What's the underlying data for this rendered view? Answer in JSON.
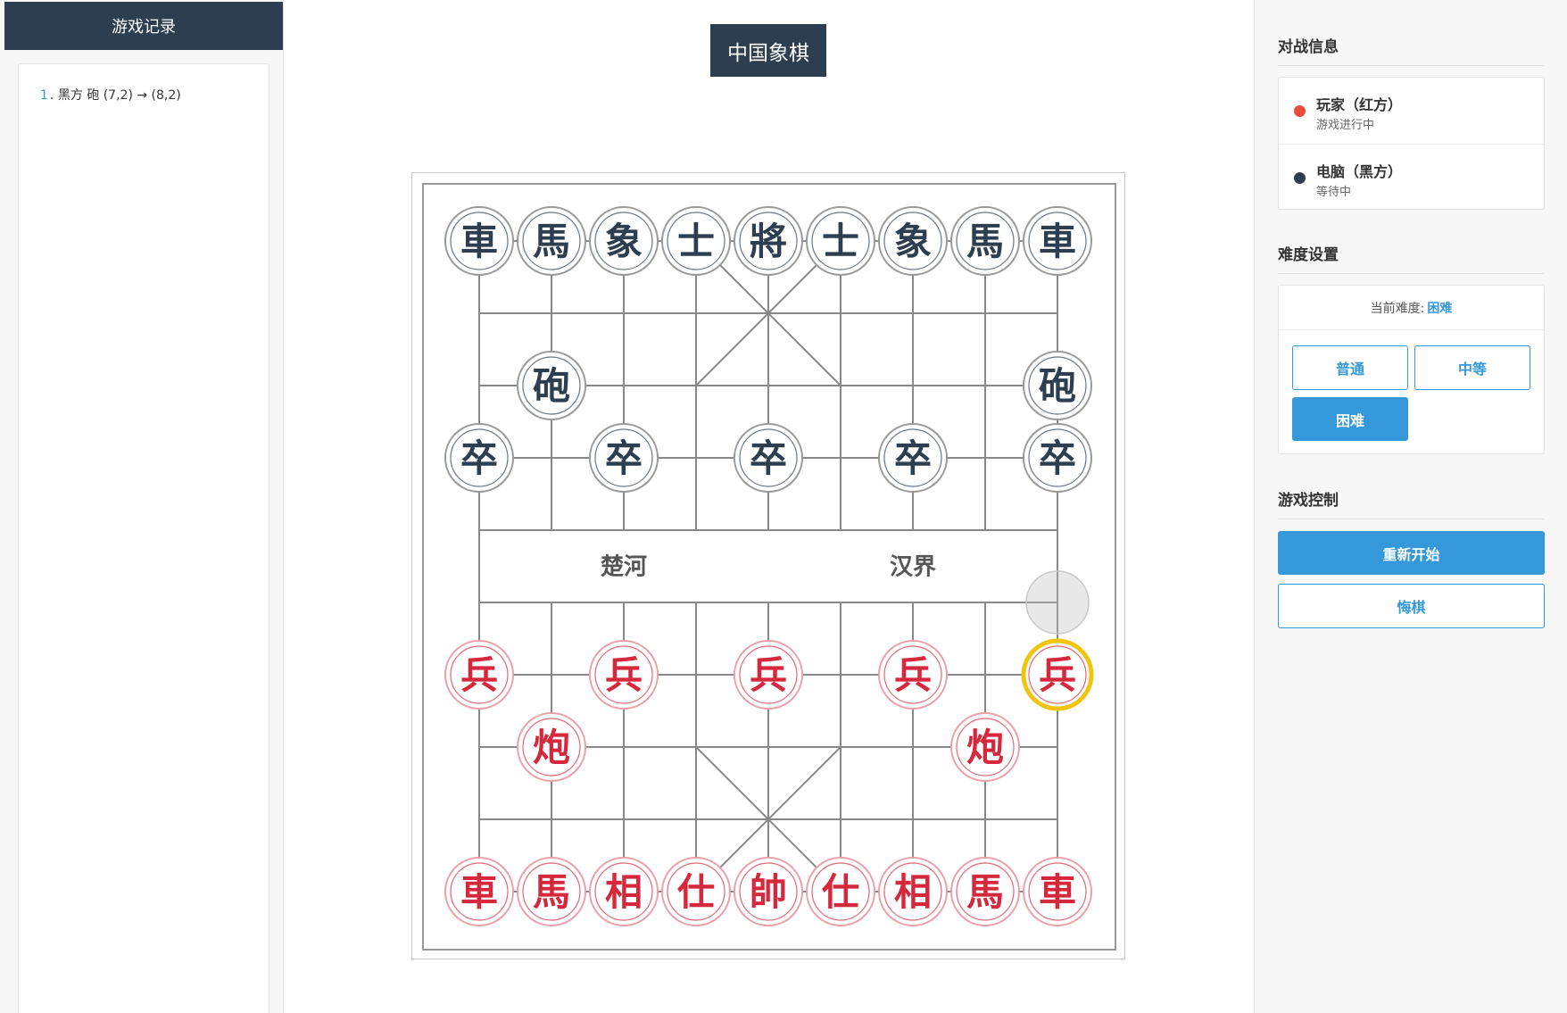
{
  "log": {
    "title": "游戏记录",
    "entries": [
      {
        "num": "1",
        "text": ". 黑方 砲 (7,2) → (8,2)"
      }
    ]
  },
  "title": "中国象棋",
  "board": {
    "river_left": "楚河",
    "river_right": "汉界",
    "colors": {
      "red": "#d6283c",
      "black": "#2c3e50",
      "line": "#888888",
      "highlight": "#f1c40f"
    },
    "last_move_from": {
      "col": 8,
      "row": 5
    },
    "selected": {
      "col": 8,
      "row": 6
    },
    "pieces": [
      {
        "side": "black",
        "char": "車",
        "col": 0,
        "row": 0
      },
      {
        "side": "black",
        "char": "馬",
        "col": 1,
        "row": 0
      },
      {
        "side": "black",
        "char": "象",
        "col": 2,
        "row": 0
      },
      {
        "side": "black",
        "char": "士",
        "col": 3,
        "row": 0
      },
      {
        "side": "black",
        "char": "將",
        "col": 4,
        "row": 0
      },
      {
        "side": "black",
        "char": "士",
        "col": 5,
        "row": 0
      },
      {
        "side": "black",
        "char": "象",
        "col": 6,
        "row": 0
      },
      {
        "side": "black",
        "char": "馬",
        "col": 7,
        "row": 0
      },
      {
        "side": "black",
        "char": "車",
        "col": 8,
        "row": 0
      },
      {
        "side": "black",
        "char": "砲",
        "col": 1,
        "row": 2
      },
      {
        "side": "black",
        "char": "砲",
        "col": 8,
        "row": 2
      },
      {
        "side": "black",
        "char": "卒",
        "col": 0,
        "row": 3
      },
      {
        "side": "black",
        "char": "卒",
        "col": 2,
        "row": 3
      },
      {
        "side": "black",
        "char": "卒",
        "col": 4,
        "row": 3
      },
      {
        "side": "black",
        "char": "卒",
        "col": 6,
        "row": 3
      },
      {
        "side": "black",
        "char": "卒",
        "col": 8,
        "row": 3
      },
      {
        "side": "red",
        "char": "兵",
        "col": 0,
        "row": 6
      },
      {
        "side": "red",
        "char": "兵",
        "col": 2,
        "row": 6
      },
      {
        "side": "red",
        "char": "兵",
        "col": 4,
        "row": 6
      },
      {
        "side": "red",
        "char": "兵",
        "col": 6,
        "row": 6
      },
      {
        "side": "red",
        "char": "兵",
        "col": 8,
        "row": 6
      },
      {
        "side": "red",
        "char": "炮",
        "col": 1,
        "row": 7
      },
      {
        "side": "red",
        "char": "炮",
        "col": 7,
        "row": 7
      },
      {
        "side": "red",
        "char": "車",
        "col": 0,
        "row": 9
      },
      {
        "side": "red",
        "char": "馬",
        "col": 1,
        "row": 9
      },
      {
        "side": "red",
        "char": "相",
        "col": 2,
        "row": 9
      },
      {
        "side": "red",
        "char": "仕",
        "col": 3,
        "row": 9
      },
      {
        "side": "red",
        "char": "帥",
        "col": 4,
        "row": 9
      },
      {
        "side": "red",
        "char": "仕",
        "col": 5,
        "row": 9
      },
      {
        "side": "red",
        "char": "相",
        "col": 6,
        "row": 9
      },
      {
        "side": "red",
        "char": "馬",
        "col": 7,
        "row": 9
      },
      {
        "side": "red",
        "char": "車",
        "col": 8,
        "row": 9
      }
    ]
  },
  "battle": {
    "title": "对战信息",
    "players": [
      {
        "name": "玩家（红方）",
        "status": "游戏进行中",
        "color": "#e74c3c"
      },
      {
        "name": "电脑（黑方）",
        "status": "等待中",
        "color": "#2c3e50"
      }
    ]
  },
  "difficulty": {
    "title": "难度设置",
    "current_label": "当前难度:",
    "current_value": "困难",
    "options": [
      "普通",
      "中等",
      "困难"
    ]
  },
  "controls": {
    "title": "游戏控制",
    "restart": "重新开始",
    "undo": "悔棋"
  }
}
